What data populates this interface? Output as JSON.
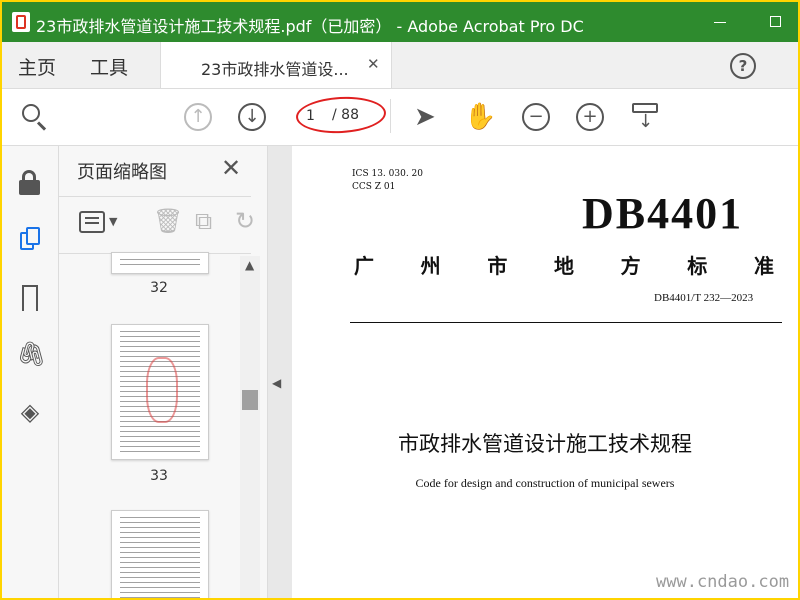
{
  "window": {
    "title": "23市政排水管道设计施工技术规程.pdf（已加密） - Adobe Acrobat Pro DC"
  },
  "nav": {
    "home": "主页",
    "tools": "工具",
    "doc_tab": "23市政排水管道设...",
    "help": "?"
  },
  "toolbar": {
    "current_page": "1",
    "total_pages": "/ 88"
  },
  "thumbnails_panel": {
    "title": "页面缩略图",
    "pages": [
      {
        "label": "32"
      },
      {
        "label": "33"
      }
    ]
  },
  "document": {
    "ics_line": "ICS 13. 030. 20",
    "ccs_line": "CCS Z 01",
    "logo": "DB4401",
    "standard_type_chars": [
      "广",
      "州",
      "市",
      "地",
      "方",
      "标",
      "准"
    ],
    "standard_number": "DB4401/T 232—2023",
    "title_cn": "市政排水管道设计施工技术规程",
    "title_en": "Code for design and construction of municipal sewers"
  },
  "watermark": "www.cndao.com",
  "colors": {
    "titlebar": "#2e8b2e",
    "frame_border": "#ffd400",
    "accent": "#1a73e8",
    "annotation": "#e02020"
  }
}
